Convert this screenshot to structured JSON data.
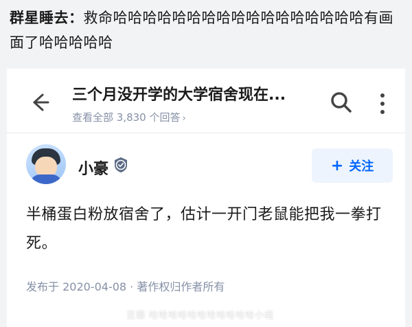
{
  "comment": {
    "author": "群星睡去",
    "separator": "：",
    "text": "救命哈哈哈哈哈哈哈哈哈哈哈哈哈哈哈哈哈有画面了哈哈哈哈哈"
  },
  "question": {
    "title": "三个月没开学的大学宿舍现在...",
    "view_all": "查看全部 3,830 个回答",
    "chevron": "›"
  },
  "answer": {
    "author_name": "小豪",
    "follow_label": "关注",
    "follow_plus": "+",
    "body": "半桶蛋白粉放宿舍了，估计一开门老鼠能把我一拳打死。",
    "meta": "发布于 2020-04-08 · 著作权归作者所有"
  },
  "watermark": "豆瓣  哈哈哈哈哈哈哈哈哈哈哈小组",
  "colors": {
    "accent": "#0066ff",
    "muted": "#8590a6",
    "follow_bg": "#eef4fd"
  },
  "icons": [
    "back-arrow-icon",
    "search-icon",
    "more-vertical-icon",
    "badge-icon"
  ]
}
